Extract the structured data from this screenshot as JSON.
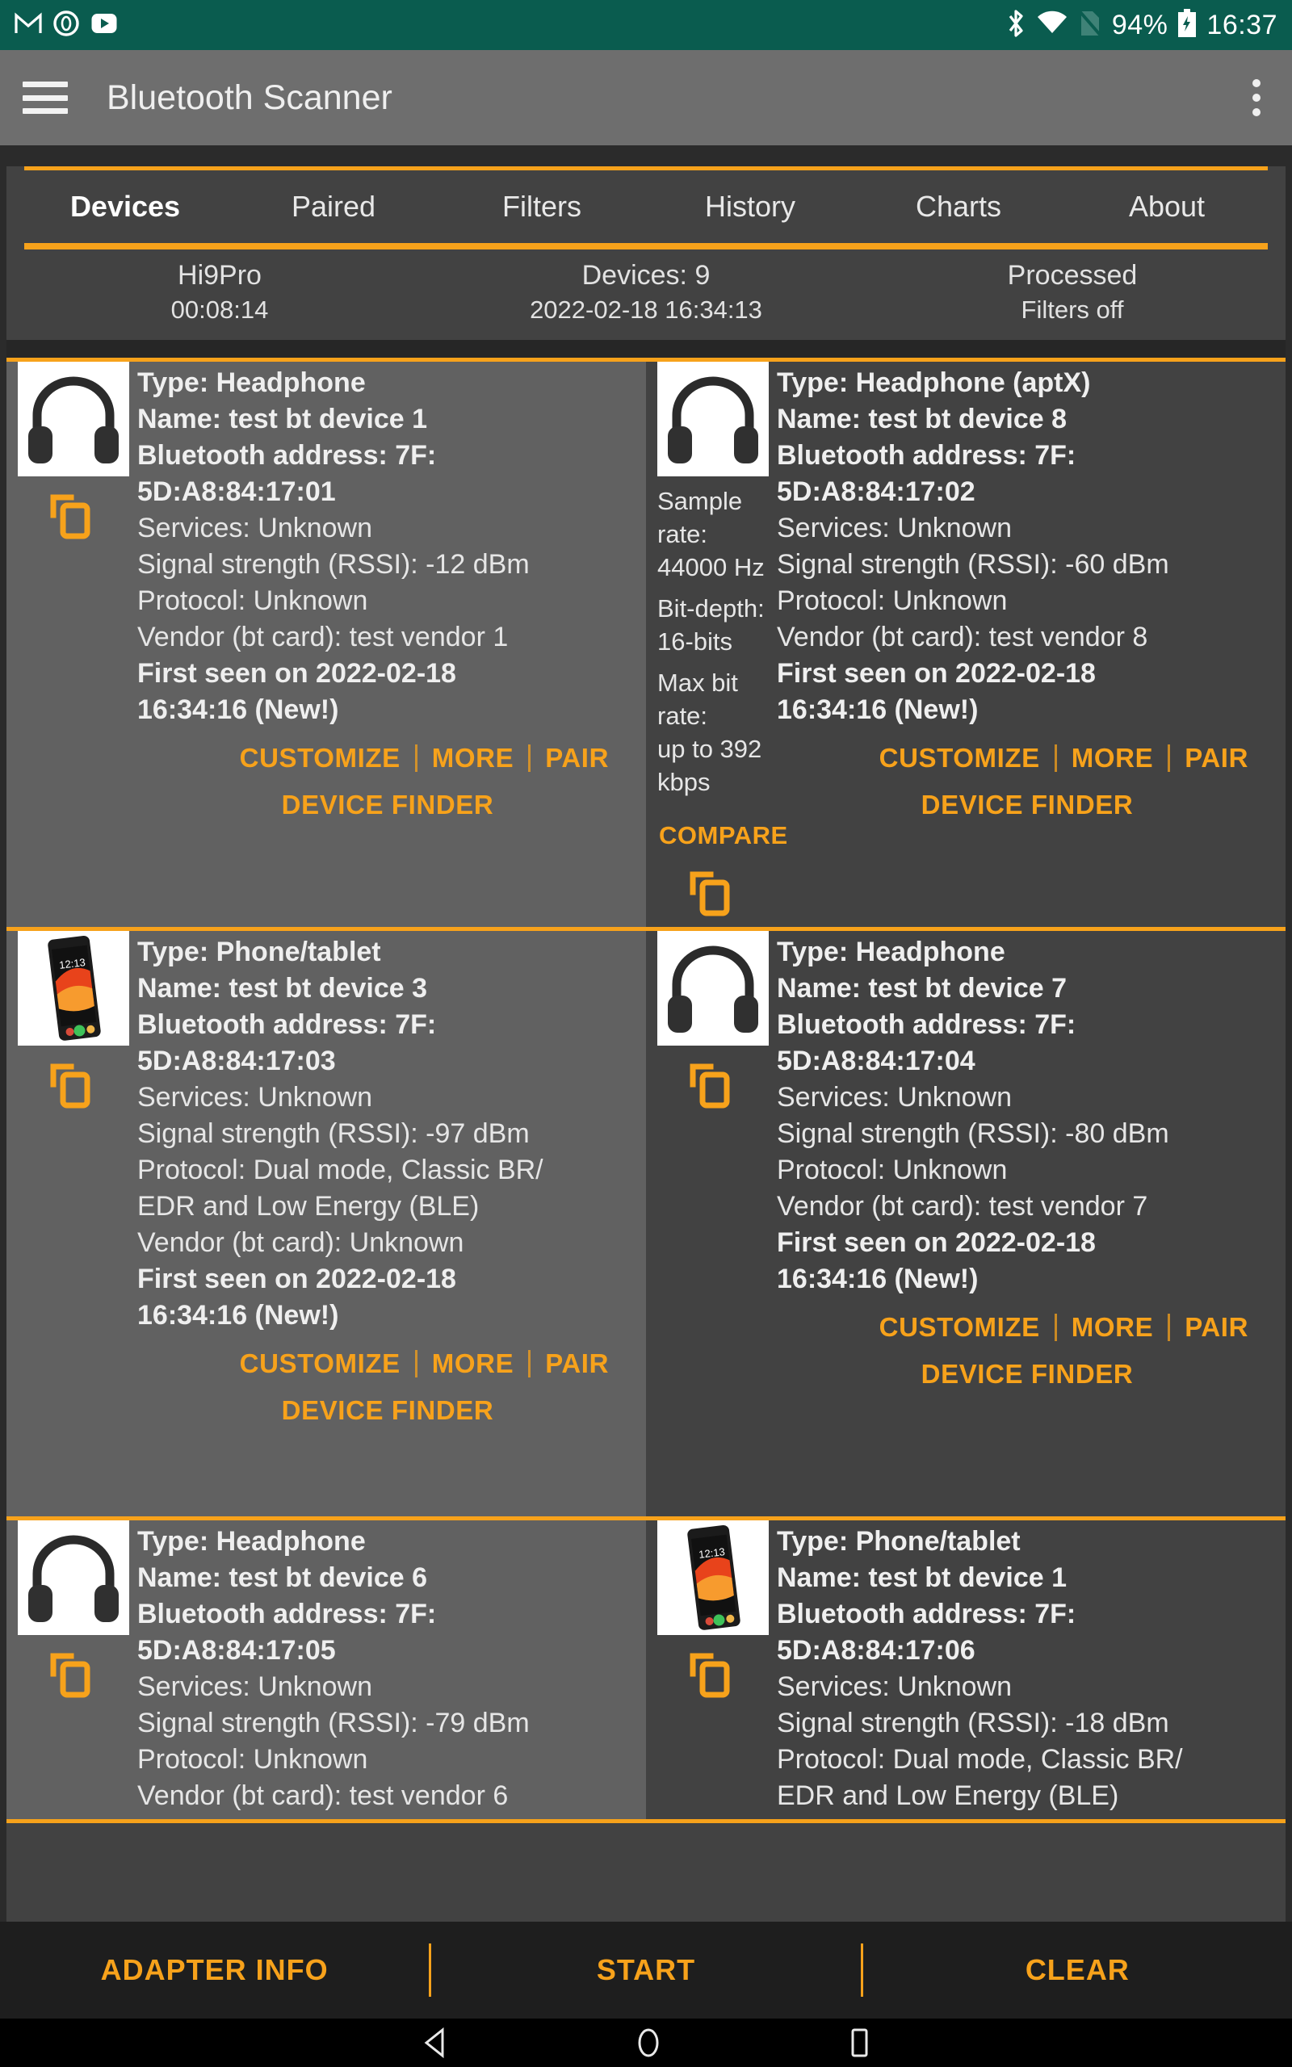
{
  "statusbar": {
    "icons_left": [
      "gmail-icon",
      "record-icon",
      "youtube-icon"
    ],
    "icons_right": [
      "bluetooth-icon",
      "wifi-icon",
      "no-sim-icon"
    ],
    "battery_percent": "94%",
    "battery_state": "charging",
    "time": "16:37",
    "bg_color": "#0a5c4f"
  },
  "appbar": {
    "title": "Bluetooth Scanner",
    "menu_icon": "hamburger-icon",
    "overflow_icon": "more-vertical-icon",
    "bg_color": "#6e6e6e"
  },
  "accent_color": "#f7a21b",
  "tabs": [
    {
      "label": "Devices",
      "active": true
    },
    {
      "label": "Paired",
      "active": false
    },
    {
      "label": "Filters",
      "active": false
    },
    {
      "label": "History",
      "active": false
    },
    {
      "label": "Charts",
      "active": false
    },
    {
      "label": "About",
      "active": false
    }
  ],
  "status_row": [
    {
      "line1": "Hi9Pro",
      "line2": "00:08:14"
    },
    {
      "line1": "Devices: 9",
      "line2": "2022-02-18 16:34:13"
    },
    {
      "line1": "Processed",
      "line2": "Filters off"
    }
  ],
  "card_actions": {
    "customize": "CUSTOMIZE",
    "more": "MORE",
    "pair": "PAIR",
    "device_finder": "DEVICE FINDER",
    "compare": "COMPARE"
  },
  "devices": [
    {
      "thumb": "headphone-image",
      "type": "Type: Headphone",
      "name": "Name: test bt device 1",
      "address_l1": "Bluetooth address: 7F:",
      "address_l2": "5D:A8:84:17:01",
      "services": "Services: Unknown",
      "rssi": "Signal strength (RSSI): -12 dBm",
      "protocol_l1": "Protocol: Unknown",
      "protocol_l2": "",
      "vendor": "Vendor (bt card): test vendor 1",
      "first_seen_l1": "First seen on 2022-02-18",
      "first_seen_l2": "16:34:16 (New!)",
      "codec": null,
      "has_compare": false
    },
    {
      "thumb": "headphone-image",
      "type": "Type: Headphone (aptX)",
      "name": "Name: test bt device 8",
      "address_l1": "Bluetooth address: 7F:",
      "address_l2": "5D:A8:84:17:02",
      "services": "Services: Unknown",
      "rssi": "Signal strength (RSSI): -60 dBm",
      "protocol_l1": "Protocol: Unknown",
      "protocol_l2": "",
      "vendor": "Vendor (bt card): test vendor 8",
      "first_seen_l1": "First seen on 2022-02-18",
      "first_seen_l2": "16:34:16 (New!)",
      "codec": {
        "sample_rate_l1": "Sample rate:",
        "sample_rate_l2": "44000 Hz",
        "bit_depth_l1": "Bit-depth:",
        "bit_depth_l2": "16-bits",
        "max_bit_rate_l1": "Max bit rate:",
        "max_bit_rate_l2": "up to 392",
        "max_bit_rate_l3": "kbps"
      },
      "has_compare": true
    },
    {
      "thumb": "phone-image",
      "type": "Type: Phone/tablet",
      "name": "Name: test bt device 3",
      "address_l1": "Bluetooth address: 7F:",
      "address_l2": "5D:A8:84:17:03",
      "services": "Services: Unknown",
      "rssi": "Signal strength (RSSI): -97 dBm",
      "protocol_l1": "Protocol: Dual mode, Classic BR/",
      "protocol_l2": "EDR and Low Energy (BLE)",
      "vendor": "Vendor (bt card): Unknown",
      "first_seen_l1": "First seen on 2022-02-18",
      "first_seen_l2": "16:34:16 (New!)",
      "codec": null,
      "has_compare": false
    },
    {
      "thumb": "headphone-image",
      "type": "Type: Headphone",
      "name": "Name: test bt device 7",
      "address_l1": "Bluetooth address: 7F:",
      "address_l2": "5D:A8:84:17:04",
      "services": "Services: Unknown",
      "rssi": "Signal strength (RSSI): -80 dBm",
      "protocol_l1": "Protocol: Unknown",
      "protocol_l2": "",
      "vendor": "Vendor (bt card): test vendor 7",
      "first_seen_l1": "First seen on 2022-02-18",
      "first_seen_l2": "16:34:16 (New!)",
      "codec": null,
      "has_compare": false
    },
    {
      "thumb": "headphone-image",
      "type": "Type: Headphone",
      "name": "Name: test bt device 6",
      "address_l1": "Bluetooth address: 7F:",
      "address_l2": "5D:A8:84:17:05",
      "services": "Services: Unknown",
      "rssi": "Signal strength (RSSI): -79 dBm",
      "protocol_l1": "Protocol: Unknown",
      "protocol_l2": "",
      "vendor": "Vendor (bt card): test vendor 6",
      "first_seen_l1": "",
      "first_seen_l2": "",
      "codec": null,
      "has_compare": false
    },
    {
      "thumb": "phone-image",
      "type": "Type: Phone/tablet",
      "name": "Name: test bt device 1",
      "address_l1": "Bluetooth address: 7F:",
      "address_l2": "5D:A8:84:17:06",
      "services": "Services: Unknown",
      "rssi": "Signal strength (RSSI): -18 dBm",
      "protocol_l1": "Protocol: Dual mode, Classic BR/",
      "protocol_l2": "EDR and Low Energy (BLE)",
      "vendor": "",
      "first_seen_l1": "",
      "first_seen_l2": "",
      "codec": null,
      "has_compare": false
    }
  ],
  "bottom_toolbar": {
    "adapter_info": "ADAPTER INFO",
    "start": "START",
    "clear": "CLEAR"
  },
  "navbar": {
    "back": "back-icon",
    "home": "home-icon",
    "recents": "recents-icon"
  },
  "phone_thumb": {
    "clock": "12:13"
  }
}
